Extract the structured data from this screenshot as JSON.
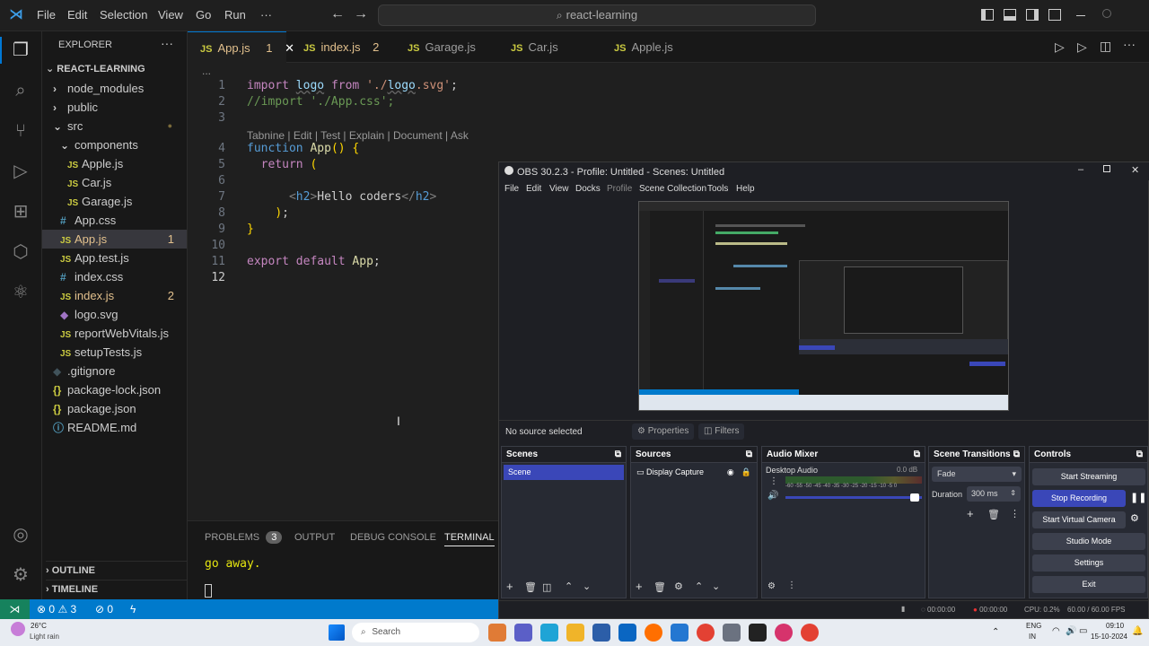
{
  "titlebar": {
    "menu": [
      "File",
      "Edit",
      "Selection",
      "View",
      "Go",
      "Run",
      "···"
    ],
    "search": "react-learning"
  },
  "explorer": {
    "header": "EXPLORER",
    "root": "REACT-LEARNING",
    "items": [
      {
        "label": "node_modules",
        "kind": "folder-closed",
        "indent": 1
      },
      {
        "label": "public",
        "kind": "folder-closed",
        "indent": 1
      },
      {
        "label": "src",
        "kind": "folder-open",
        "indent": 1,
        "dot": true
      },
      {
        "label": "components",
        "kind": "folder-open",
        "indent": 2
      },
      {
        "label": "Apple.js",
        "kind": "js",
        "indent": 3
      },
      {
        "label": "Car.js",
        "kind": "js",
        "indent": 3
      },
      {
        "label": "Garage.js",
        "kind": "js",
        "indent": 3
      },
      {
        "label": "App.css",
        "kind": "css",
        "indent": 2
      },
      {
        "label": "App.js",
        "kind": "js",
        "indent": 2,
        "badge": "1",
        "selected": true
      },
      {
        "label": "App.test.js",
        "kind": "js",
        "indent": 2
      },
      {
        "label": "index.css",
        "kind": "css",
        "indent": 2
      },
      {
        "label": "index.js",
        "kind": "js",
        "indent": 2,
        "badge": "2"
      },
      {
        "label": "logo.svg",
        "kind": "svg",
        "indent": 2
      },
      {
        "label": "reportWebVitals.js",
        "kind": "js",
        "indent": 2
      },
      {
        "label": "setupTests.js",
        "kind": "js",
        "indent": 2
      },
      {
        "label": ".gitignore",
        "kind": "git",
        "indent": 1
      },
      {
        "label": "package-lock.json",
        "kind": "json",
        "indent": 1
      },
      {
        "label": "package.json",
        "kind": "json",
        "indent": 1
      },
      {
        "label": "README.md",
        "kind": "md",
        "indent": 1
      }
    ],
    "outline": "OUTLINE",
    "timeline": "TIMELINE"
  },
  "tabs": [
    {
      "label": "App.js",
      "badge": "1",
      "active": true
    },
    {
      "label": "index.js",
      "badge": "2"
    },
    {
      "label": "Garage.js",
      "badge": ""
    },
    {
      "label": "Car.js",
      "badge": ""
    },
    {
      "label": "Apple.js",
      "badge": ""
    }
  ],
  "editor": {
    "breadcrumb": "...",
    "codelens": "Tabnine | Edit | Test | Explain | Document | Ask",
    "lines": [
      {
        "n": "1",
        "text": "import logo from './logo.svg';"
      },
      {
        "n": "2",
        "text": "//import './App.css';"
      },
      {
        "n": "3",
        "text": ""
      },
      {
        "n": "4",
        "text": "function App() {"
      },
      {
        "n": "5",
        "text": "  return ("
      },
      {
        "n": "6",
        "text": ""
      },
      {
        "n": "7",
        "text": "      <h2>Hello coders</h2>"
      },
      {
        "n": "8",
        "text": "    );"
      },
      {
        "n": "9",
        "text": "}"
      },
      {
        "n": "10",
        "text": ""
      },
      {
        "n": "11",
        "text": "export default App;"
      },
      {
        "n": "12",
        "text": ""
      }
    ]
  },
  "panel": {
    "tabs": [
      "PROBLEMS",
      "OUTPUT",
      "DEBUG CONSOLE",
      "TERMINAL"
    ],
    "problems_count": "3",
    "terminal_text": "go away."
  },
  "status": {
    "errors": "0",
    "warnings": "3",
    "ports": "0"
  },
  "obs": {
    "title": "OBS 30.2.3 - Profile: Untitled - Scenes: Untitled",
    "menu": [
      "File",
      "Edit",
      "View",
      "Docks",
      "Profile",
      "Scene Collection",
      "Tools",
      "Help"
    ],
    "no_source": "No source selected",
    "properties": "Properties",
    "filters": "Filters",
    "docks": {
      "scenes": "Scenes",
      "sources": "Sources",
      "mixer": "Audio Mixer",
      "transitions": "Scene Transitions",
      "controls": "Controls"
    },
    "scene_item": "Scene",
    "source_item": "Display Capture",
    "mixer": {
      "channel": "Desktop Audio",
      "level": "0.0 dB",
      "ticks": "-60 -55 -50 -45 -40 -35 -30 -25 -20 -15 -10 -5 0"
    },
    "transition": {
      "type": "Fade",
      "duration_label": "Duration",
      "duration": "300 ms"
    },
    "controls": [
      "Start Streaming",
      "Stop Recording",
      "Start Virtual Camera",
      "Studio Mode",
      "Settings",
      "Exit"
    ],
    "statusbar": {
      "stream": "00:00:00",
      "rec": "00:00:00",
      "cpu": "CPU: 0.2%",
      "fps": "60.00 / 60.00 FPS"
    }
  },
  "taskbar": {
    "weather_temp": "26°C",
    "weather_desc": "Light rain",
    "search": "Search",
    "lang1": "ENG",
    "lang2": "IN",
    "time": "09:10",
    "date": "15-10-2024"
  }
}
